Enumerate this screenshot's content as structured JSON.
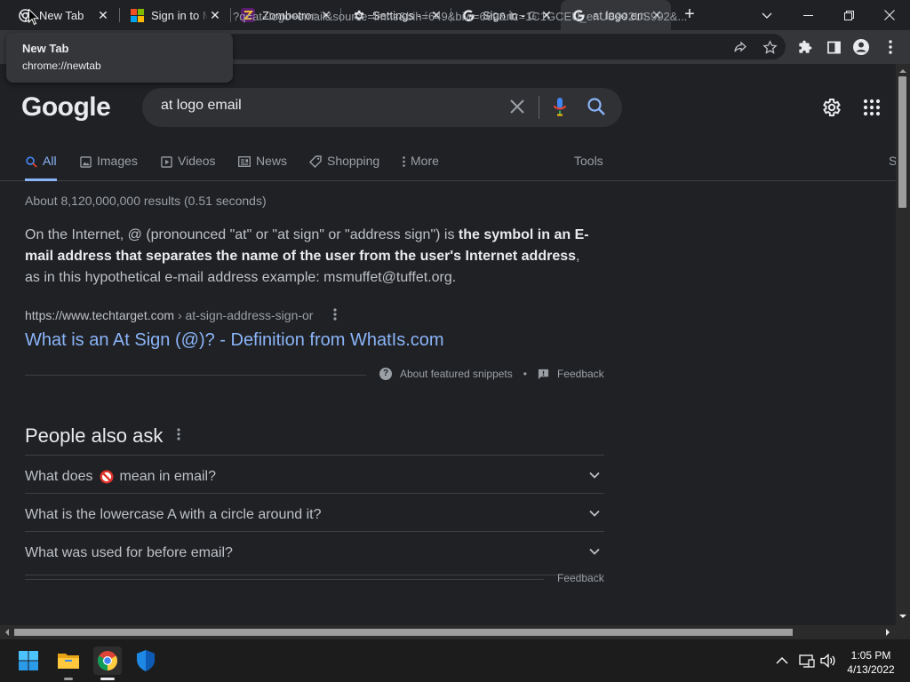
{
  "browser": {
    "tabs": [
      {
        "title": "New Tab",
        "icon": "chrome-icon"
      },
      {
        "title": "Sign in to Microsoft",
        "icon": "microsoft-icon"
      },
      {
        "title": "Zombotron",
        "icon": "zombotron-icon"
      },
      {
        "title": "Settings - Profiles",
        "icon": "gear-icon"
      },
      {
        "title": "Sign in - Google",
        "icon": "google-icon"
      },
      {
        "title": "at logo email - Google",
        "icon": "google-icon",
        "active": true
      }
    ],
    "url": "?q=at+logo+email&source=lmns&bih=649&biw=669&rlz=1C1GCEU_enUS992US992&...",
    "tooltip": {
      "title": "New Tab",
      "subtitle": "chrome://newtab"
    }
  },
  "search": {
    "logo": "Google",
    "query": "at logo email",
    "tabs": [
      "All",
      "Images",
      "Videos",
      "News",
      "Shopping",
      "More"
    ],
    "tools_label": "Tools",
    "overflow_tab_label": "S",
    "stats": "About 8,120,000,000 results (0.51 seconds)"
  },
  "featured": {
    "lead": "On the Internet, @ (pronounced \"at\" or \"at sign\" or \"address sign\") is ",
    "bold": "the symbol in an E-mail address that separates the name of the user from the user's Internet address",
    "tail": ", as in this hypothetical e-mail address example: msmuffet@tuffet.org.",
    "cite_domain": "https://www.techtarget.com",
    "cite_path": " › at-sign-address-sign-or",
    "link_title": "What is an At Sign (@)? - Definition from WhatIs.com",
    "about_label": "About featured snippets",
    "dot": "•",
    "feedback_label": "Feedback"
  },
  "paa": {
    "title": "People also ask",
    "q1_before": "What does",
    "q1_after": "mean in email?",
    "q2": "What is the lowercase A with a circle around it?",
    "q3": "What was used for before email?",
    "feedback_label": "Feedback"
  },
  "taskbar": {
    "time": "1:05 PM",
    "date": "4/13/2022"
  },
  "colors": {
    "background": "#202124",
    "link": "#8ab4f8",
    "text": "#bdc1c6"
  }
}
